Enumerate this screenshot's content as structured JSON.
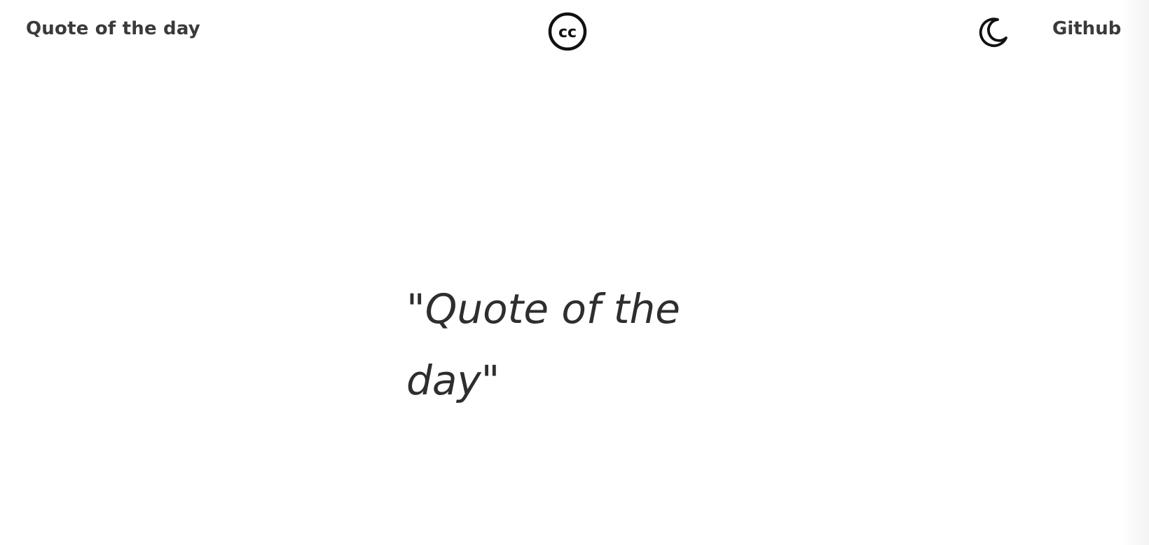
{
  "header": {
    "brand": "Quote of the day",
    "license_icon": "creative-commons-icon",
    "theme_icon": "moon-icon",
    "github_label": "Github"
  },
  "main": {
    "quote": "\"Quote of the day\""
  }
}
